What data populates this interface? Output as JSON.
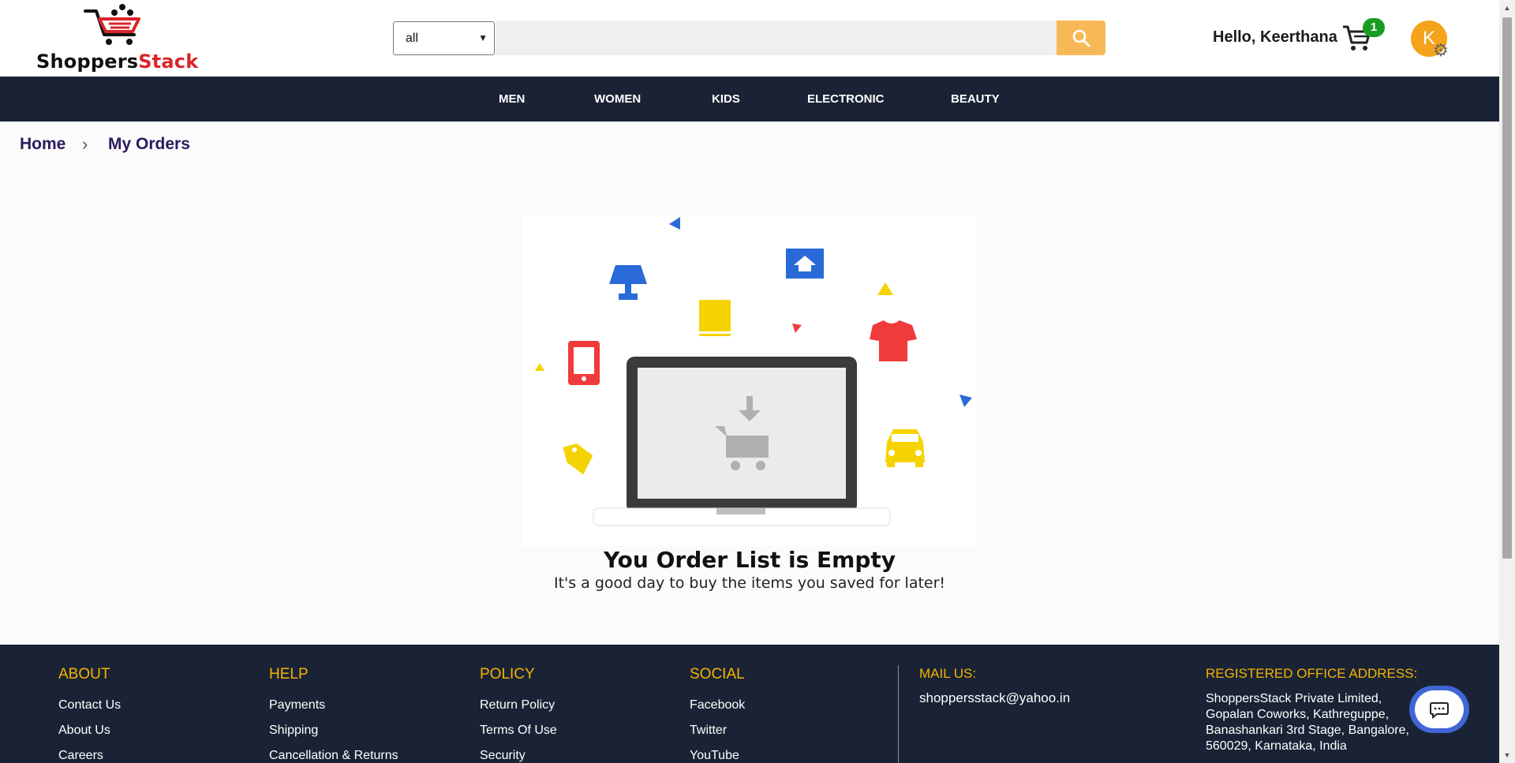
{
  "header": {
    "logo_text_main": "Shoppers",
    "logo_text_accent": "Stack",
    "search_category": "all",
    "search_placeholder": "",
    "greeting": "Hello, Keerthana",
    "cart_count": "1",
    "avatar_initial": "K"
  },
  "nav": {
    "categories": [
      "MEN",
      "WOMEN",
      "KIDS",
      "ELECTRONIC",
      "BEAUTY"
    ]
  },
  "breadcrumb": {
    "home": "Home",
    "separator": "›",
    "current": "My Orders"
  },
  "empty_state": {
    "title": "You Order List is Empty",
    "subtitle": "It's a good day to buy the items you saved for later!"
  },
  "footer": {
    "about": {
      "title": "ABOUT",
      "links": [
        "Contact Us",
        "About Us",
        "Careers"
      ]
    },
    "help": {
      "title": "HELP",
      "links": [
        "Payments",
        "Shipping",
        "Cancellation & Returns"
      ]
    },
    "policy": {
      "title": "POLICY",
      "links": [
        "Return Policy",
        "Terms Of Use",
        "Security"
      ]
    },
    "social": {
      "title": "SOCIAL",
      "links": [
        "Facebook",
        "Twitter",
        "YouTube"
      ]
    },
    "mail": {
      "title": "MAIL US:",
      "email": "shoppersstack@yahoo.in"
    },
    "office": {
      "title": "REGISTERED OFFICE ADDRESS:",
      "lines": [
        "ShoppersStack Private Limited,",
        "Gopalan Coworks, Kathreguppe,",
        "Banashankari 3rd Stage, Bangalore,",
        "560029, Karnataka, India"
      ]
    }
  },
  "colors": {
    "nav_bg": "#1a2335",
    "search_button": "#f7b957",
    "accent_yellow": "#f4b400",
    "brand_red": "#d9252b",
    "avatar": "#f5a31a",
    "badge_green": "#1a9c22"
  },
  "icons": {
    "search": "search-icon",
    "cart": "cart-icon",
    "settings": "gear-icon",
    "chat": "chat-icon"
  }
}
